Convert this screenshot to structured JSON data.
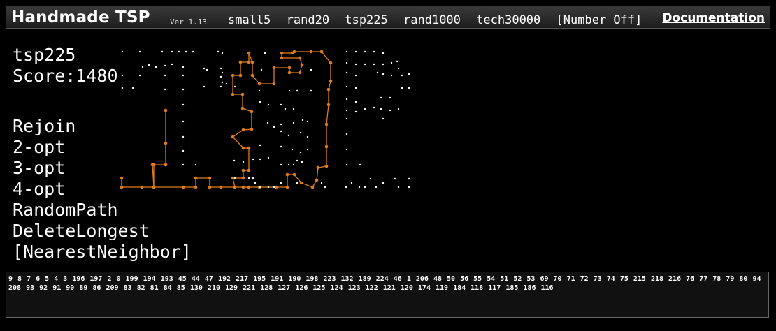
{
  "header": {
    "brand": "Handmade TSP",
    "version": "Ver 1.13",
    "nav": [
      "small5",
      "rand20",
      "tsp225",
      "rand1000",
      "tech30000",
      "[Number Off]"
    ],
    "doc_link": "Documentation"
  },
  "status": {
    "dataset": "tsp225",
    "score": "Score:1480"
  },
  "commands": [
    "Rejoin",
    "2-opt",
    "3-opt",
    "4-opt",
    "RandomPath",
    "DeleteLongest",
    "[NearestNeighbor]"
  ],
  "colors": {
    "route": "#e07b1a",
    "city": "#ffffff",
    "background": "#000000"
  },
  "path_order": "9 8 7 6 5 4 3 196 197 2 0 199 194 193 45 44 47 192 217 195 191 190 198 223 132 189 224 46 1 206 48 50 56 55 54 51 52 53 69 70 71 72 73 74 75 215 218 216 76 77 78 79 80 94 208 93 92 91 90 89 86 209 83 82 81 84 85 130 210 129 221 128 127 126 125 124 123 122 121 120 174 119 184 118 117 185 186 116"
}
